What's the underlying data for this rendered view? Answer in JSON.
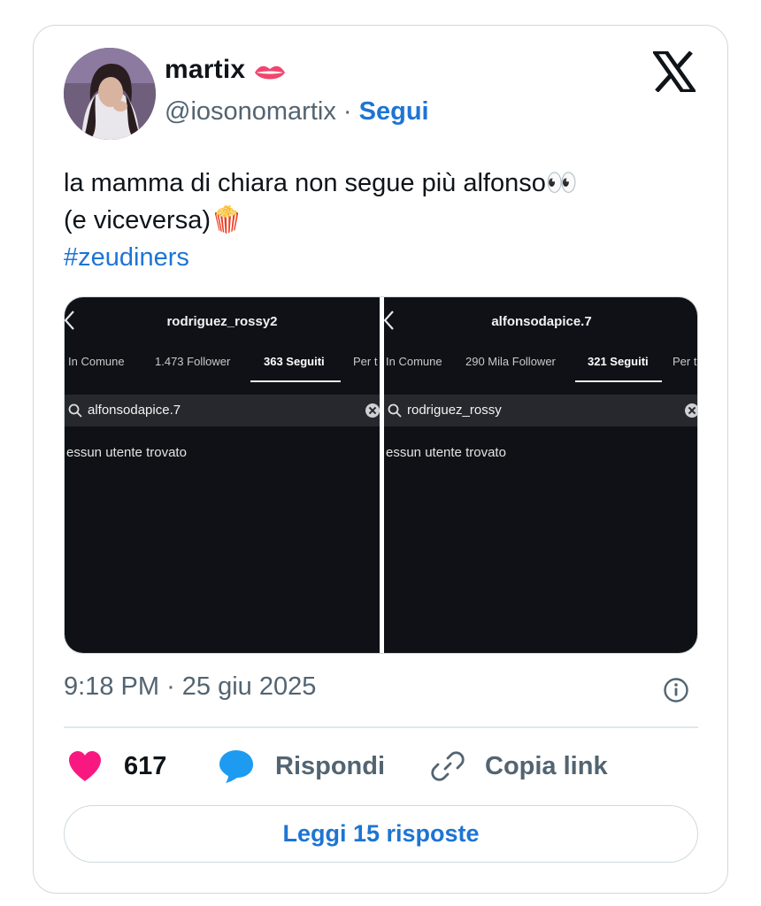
{
  "author": {
    "name": "martix",
    "name_emoji": "lips",
    "handle": "@iosonomartix",
    "separator": "·",
    "follow_label": "Segui"
  },
  "brand_icon": "x-logo-icon",
  "tweet": {
    "line1": "la mamma di chiara non segue più alfonso👀",
    "line2": "(e viceversa)🍿",
    "hashtag": "#zeudiners"
  },
  "media": {
    "left": {
      "username": "rodriguez_rossy2",
      "tabs": [
        "In Comune",
        "1.473 Follower",
        "363 Seguiti",
        "Per t"
      ],
      "active_tab": "363 Seguiti",
      "search_value": "alfonsodapice.7",
      "empty_text": "essun utente trovato"
    },
    "right": {
      "username": "alfonsodapice.7",
      "tabs": [
        "In Comune",
        "290 Mila Follower",
        "321 Seguiti",
        "Per t"
      ],
      "active_tab": "321 Seguiti",
      "search_value": "rodriguez_rossy",
      "empty_text": "essun utente trovato"
    }
  },
  "meta": {
    "time": "9:18 PM",
    "separator": "·",
    "date": "25 giu 2025"
  },
  "actions": {
    "like_count": "617",
    "reply_label": "Rispondi",
    "copy_label": "Copia link"
  },
  "read_replies_label": "Leggi 15 risposte",
  "colors": {
    "accent": "#1d75d3",
    "like": "#f91880",
    "reply_icon": "#1d9bf0",
    "muted": "#536471",
    "border": "#cfd9de"
  }
}
